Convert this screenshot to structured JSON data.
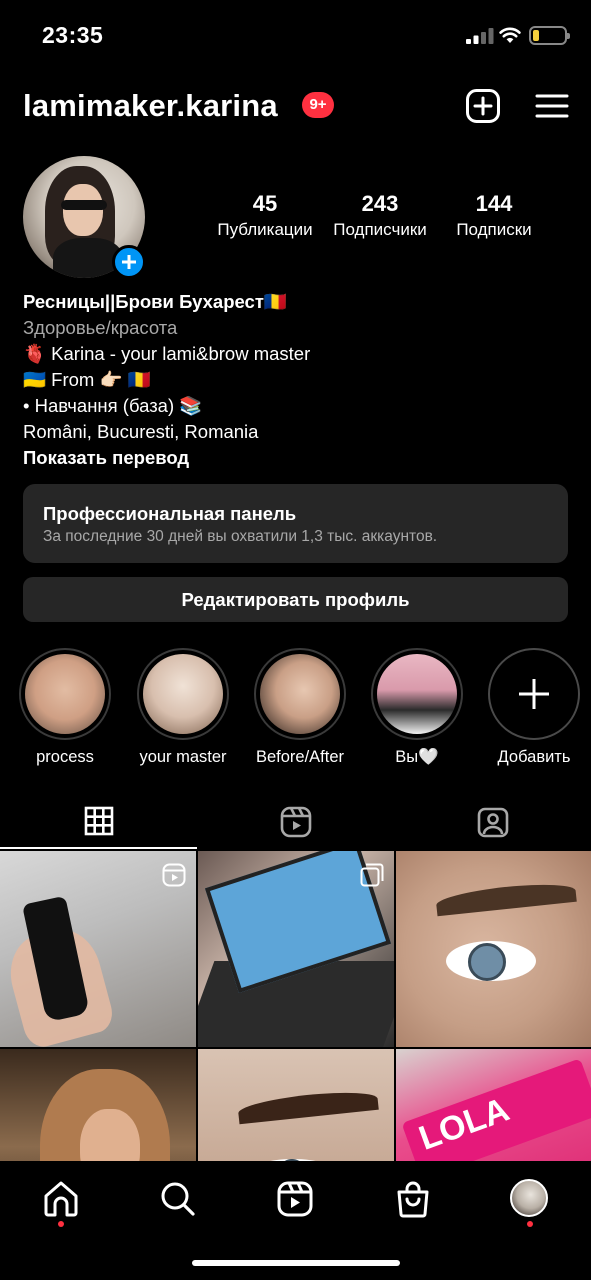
{
  "status_bar": {
    "time": "23:35"
  },
  "header": {
    "username": "lamimaker.karina",
    "notifications_badge": "9+"
  },
  "stats": [
    {
      "value": "45",
      "label": "Публикации"
    },
    {
      "value": "243",
      "label": "Подписчики"
    },
    {
      "value": "144",
      "label": "Подписки"
    }
  ],
  "bio": {
    "name": "Ресницы||Брови Бухарест🇷🇴",
    "category": "Здоровье/красота",
    "lines": [
      "🫀 Karina - your lami&brow master",
      "🇺🇦 From 👉🏻 🇷🇴",
      "• Навчання (база) 📚",
      "Români, Bucuresti, Romania"
    ],
    "show_translation": "Показать перевод"
  },
  "pro_panel": {
    "title": "Профессиональная панель",
    "subtitle": "За последние 30 дней вы охватили 1,3 тыс. аккаунтов."
  },
  "edit_profile_label": "Редактировать профиль",
  "highlights": [
    {
      "label": "process"
    },
    {
      "label": "your master"
    },
    {
      "label": "Before/After"
    },
    {
      "label": "Вы🤍"
    },
    {
      "label": "Добавить"
    }
  ],
  "grid_badges": {
    "reel_icon": "reels-icon",
    "carousel_icon": "carousel-icon"
  },
  "grid_texts": {
    "tint_brand": "LOLA"
  },
  "colors": {
    "background": "#000000",
    "accent_blue": "#0095f6",
    "badge_red": "#ff3040",
    "panel_bg": "#262626"
  }
}
